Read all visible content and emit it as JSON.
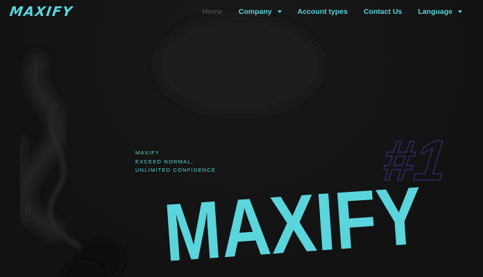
{
  "brand": {
    "logo_text": "MAXIFY",
    "accent_color": "#5ad5dc",
    "muted_nav_color": "#3e4a52",
    "rank_outline_color": "#2b2a63",
    "background_color": "#141414"
  },
  "nav": {
    "items": [
      {
        "label": "Home",
        "active": true,
        "has_dropdown": false
      },
      {
        "label": "Company",
        "active": false,
        "has_dropdown": true
      },
      {
        "label": "Account types",
        "active": false,
        "has_dropdown": false
      },
      {
        "label": "Contact Us",
        "active": false,
        "has_dropdown": false
      },
      {
        "label": "Language",
        "active": false,
        "has_dropdown": true
      }
    ],
    "dropdown_icon": "chevron-down-icon"
  },
  "hero": {
    "tagline_lines": [
      "MAXIFY",
      "EXCEED NORMAL,",
      "UNLIMITED CONFIDENCE"
    ],
    "rank_text": "#1",
    "big_title": "MAXIFY"
  }
}
